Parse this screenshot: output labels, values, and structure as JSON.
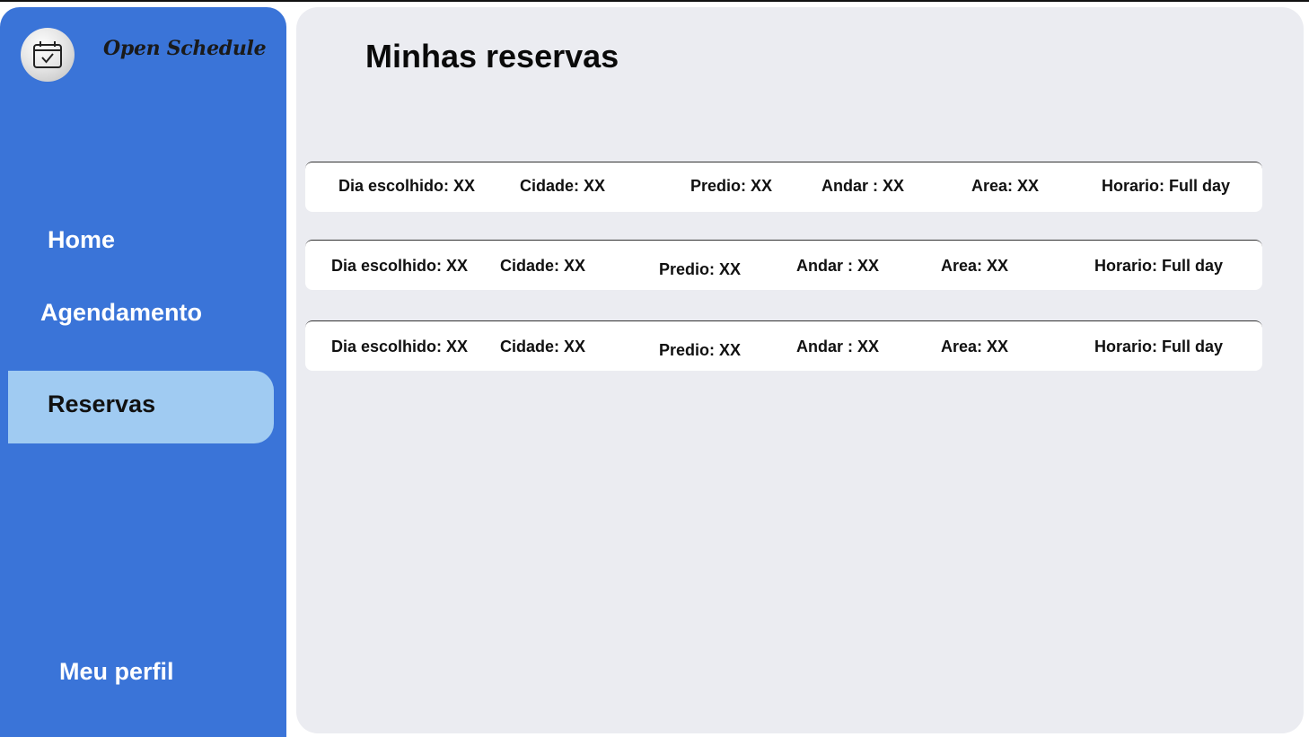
{
  "app": {
    "brand": "Open Schedule",
    "logo_icon": "calendar-check-icon"
  },
  "sidebar": {
    "items": [
      {
        "label": "Home"
      },
      {
        "label": "Agendamento"
      },
      {
        "label": "Reservas",
        "active": true
      }
    ],
    "profile_label": "Meu perfil"
  },
  "main": {
    "title": "Minhas reservas",
    "reservations": [
      {
        "dia": "Dia escolhido: XX",
        "cidade": "Cidade: XX",
        "predio": "Predio: XX",
        "andar": "Andar : XX",
        "area": "Area: XX",
        "horario": "Horario: Full day"
      },
      {
        "dia": "Dia escolhido: XX",
        "cidade": "Cidade: XX",
        "predio": "Predio: XX",
        "andar": "Andar : XX",
        "area": "Area: XX",
        "horario": "Horario: Full day"
      },
      {
        "dia": "Dia escolhido: XX",
        "cidade": "Cidade: XX",
        "predio": "Predio: XX",
        "andar": "Andar : XX",
        "area": "Area: XX",
        "horario": "Horario: Full day"
      }
    ]
  },
  "colors": {
    "sidebar": "#3a74d8",
    "active_item": "#a0cbf2",
    "main_bg": "#ebecf1"
  }
}
